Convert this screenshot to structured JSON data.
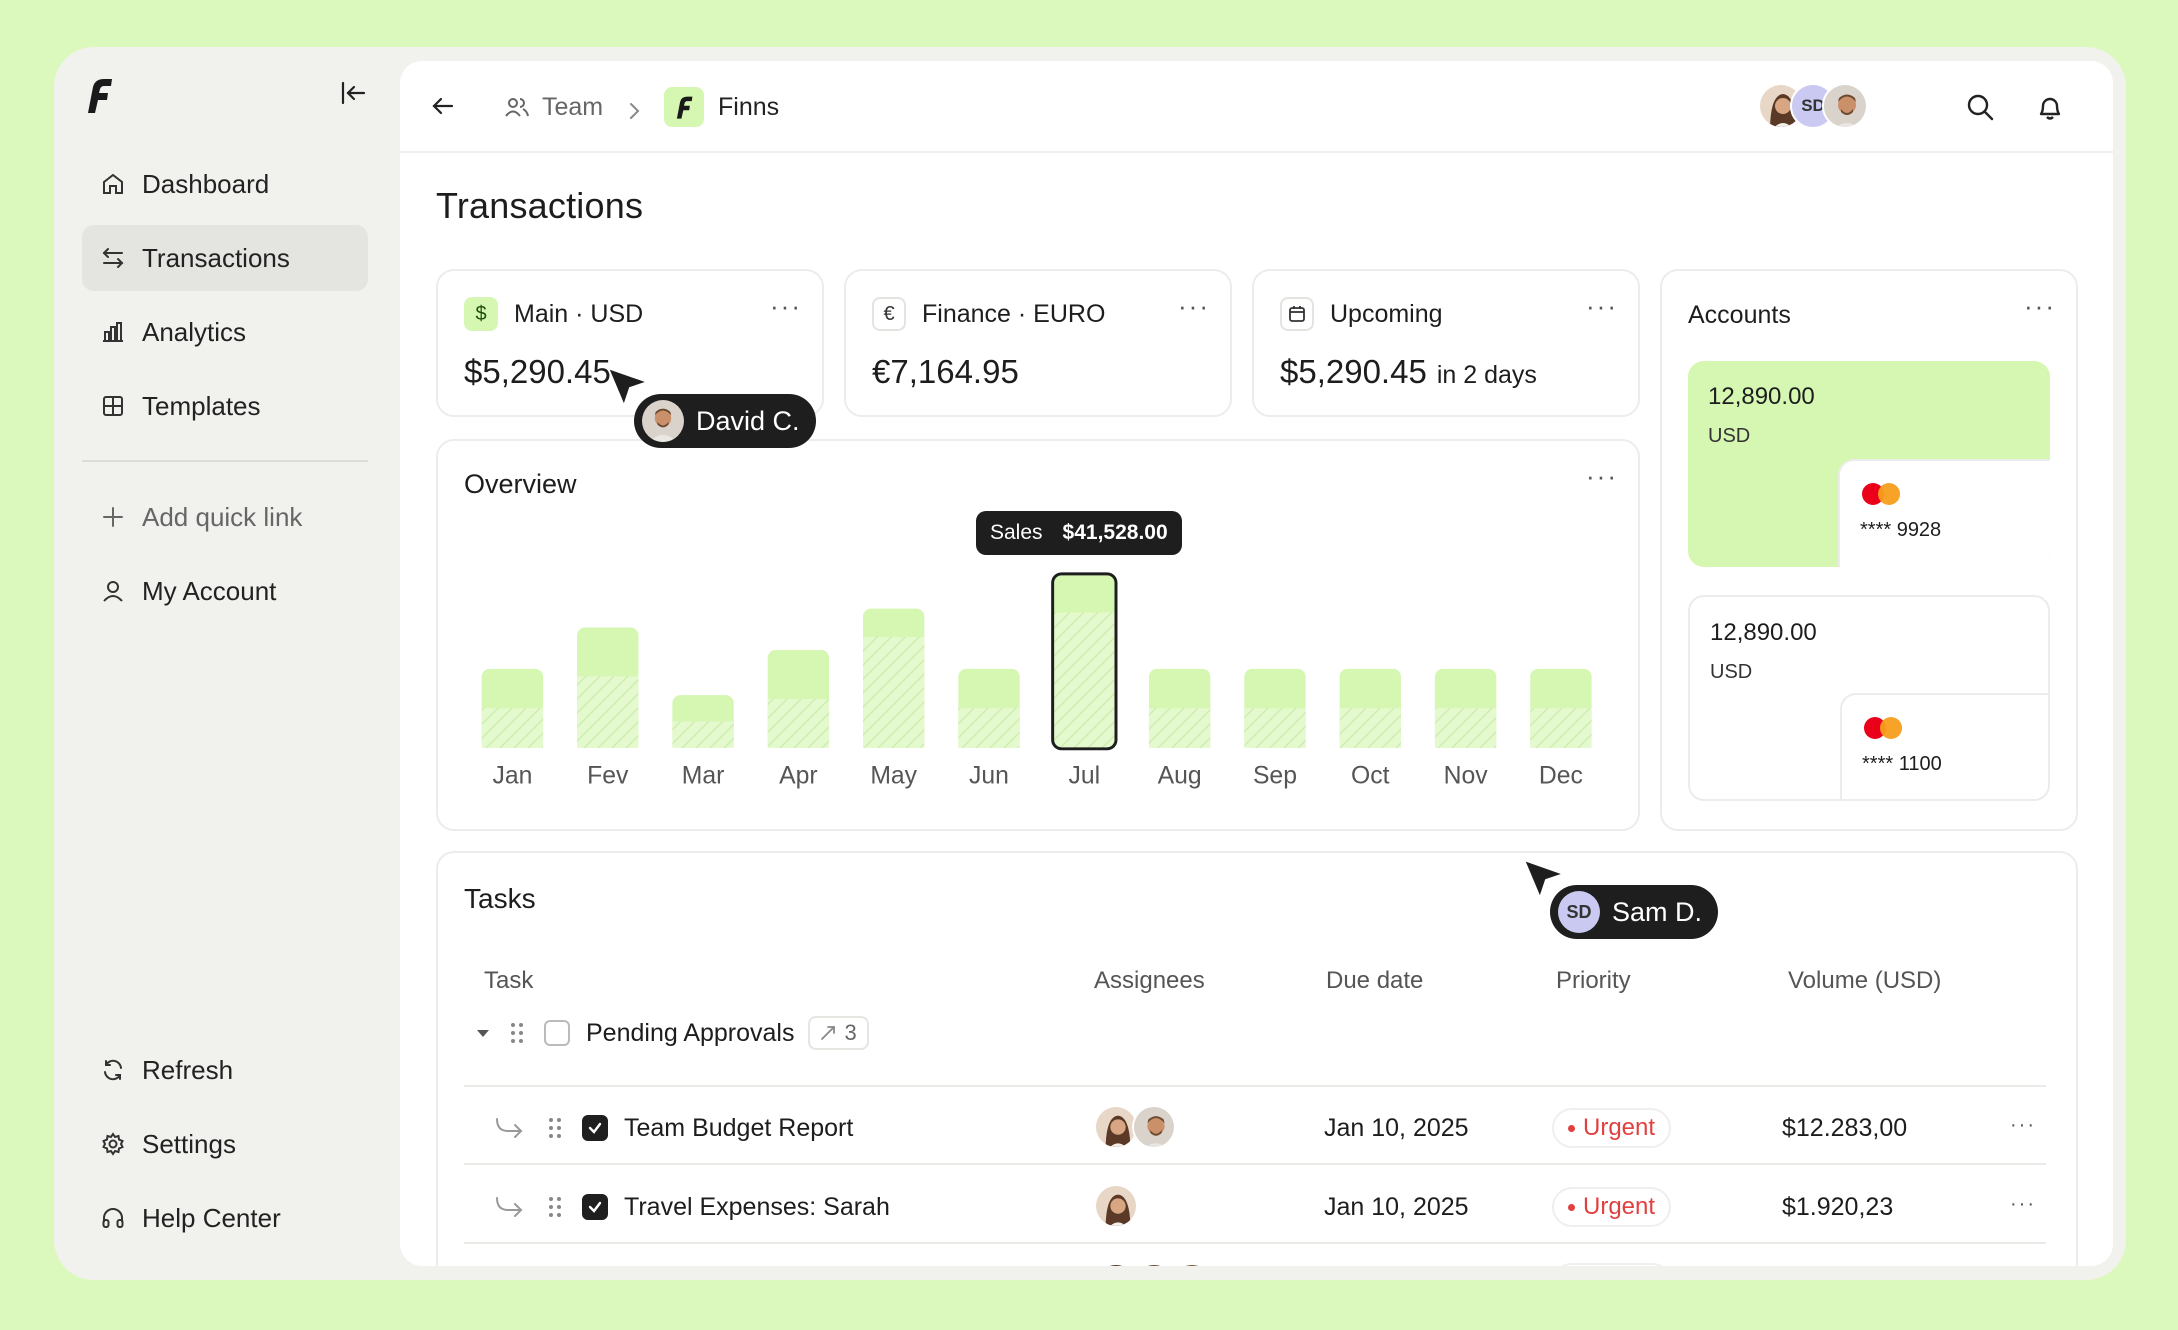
{
  "sidebar": {
    "logo": "finns-logo",
    "collapse_icon": "collapse-sidebar-icon",
    "nav": [
      {
        "label": "Dashboard",
        "icon": "home-icon"
      },
      {
        "label": "Transactions",
        "icon": "swap-icon",
        "active": true
      },
      {
        "label": "Analytics",
        "icon": "bar-chart-icon"
      },
      {
        "label": "Templates",
        "icon": "grid-icon"
      }
    ],
    "add_quick_link": "Add quick link",
    "my_account": "My Account",
    "bottom": [
      {
        "label": "Refresh",
        "icon": "refresh-icon"
      },
      {
        "label": "Settings",
        "icon": "gear-icon"
      },
      {
        "label": "Help Center",
        "icon": "headphones-icon"
      }
    ]
  },
  "topbar": {
    "breadcrumb": [
      "Team",
      "Finns"
    ],
    "avatars": [
      "woman",
      "SD",
      "man"
    ]
  },
  "page_title": "Transactions",
  "stats": [
    {
      "label": "Main · USD",
      "badge": "$",
      "value": "$5,290.45"
    },
    {
      "label": "Finance · EURO",
      "badge": "€",
      "value": "€7,164.95"
    },
    {
      "label": "Upcoming",
      "badge": "calendar",
      "value": "$5,290.45",
      "suffix": "in 2 days"
    }
  ],
  "overview": {
    "title": "Overview",
    "tooltip": {
      "label": "Sales",
      "value": "$41,528.00"
    }
  },
  "chart_data": {
    "type": "bar",
    "categories": [
      "Jan",
      "Fev",
      "Mar",
      "Apr",
      "May",
      "Jun",
      "Jul",
      "Aug",
      "Sep",
      "Oct",
      "Nov",
      "Dec"
    ],
    "series": [
      {
        "values": [
          42,
          64,
          28,
          52,
          74,
          42,
          92,
          42,
          42,
          42,
          42,
          42
        ]
      },
      {
        "values": [
          21,
          38,
          14,
          26,
          59,
          21,
          72,
          21,
          21,
          21,
          21,
          21
        ]
      }
    ],
    "highlight": "Jul"
  },
  "accounts": {
    "title": "Accounts",
    "items": [
      {
        "amount": "12,890.00",
        "currency": "USD",
        "card": "**** 9928",
        "selected": true
      },
      {
        "amount": "12,890.00",
        "currency": "USD",
        "card": "**** 1100",
        "selected": false
      }
    ]
  },
  "tasks": {
    "title": "Tasks",
    "columns": [
      "Task",
      "Assignees",
      "Due date",
      "Priority",
      "Volume (USD)"
    ],
    "group": {
      "name": "Pending Approvals",
      "count": "3"
    },
    "rows": [
      {
        "task": "Team Budget Report",
        "assignees": [
          "woman",
          "man"
        ],
        "due": "Jan 10, 2025",
        "priority": "Urgent",
        "volume": "$12.283,00"
      },
      {
        "task": "Travel Expenses: Sarah",
        "assignees": [
          "woman"
        ],
        "due": "Jan 10, 2025",
        "priority": "Urgent",
        "volume": "$1.920,23"
      }
    ]
  },
  "cursors": [
    {
      "name": "David C."
    },
    {
      "name": "Sam D.",
      "initials": "SD"
    }
  ],
  "colors": {
    "accent": "#d5f7b2",
    "accent_dark": "#b7ec8a",
    "background": "#dcf9bd",
    "urgent": "#e24040"
  }
}
